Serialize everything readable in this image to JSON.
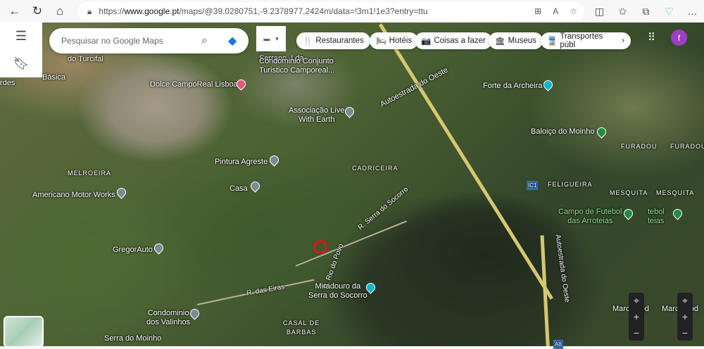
{
  "browser": {
    "url_prefix": "https://",
    "url_domain": "www.google.pt",
    "url_rest": "/maps/@39.0280751,-9.2378977,2424m/data=!3m1!1e3?entry=ttu"
  },
  "search": {
    "placeholder": "Pesquisar no Google Maps"
  },
  "chips": [
    {
      "icon": "🍴",
      "label": "Restaurantes"
    },
    {
      "icon": "🛏",
      "label": "Hotéis"
    },
    {
      "icon": "📷",
      "label": "Coisas a fazer"
    },
    {
      "icon": "🏛",
      "label": "Museus"
    },
    {
      "icon": "🚆",
      "label": "Transportes públ"
    }
  ],
  "avatar": "f",
  "map_labels": {
    "turcifal": "do Turcifal",
    "serrano": "Sar\nSerrano, Lda",
    "condominio": "Condominio Conjunto\nTuristico Camporeal...",
    "dolce": "Dolce CampoReal Lisboa",
    "associacao": "Associação Live\nWith Earth",
    "autoestrada1": "Autoestrada do Oeste",
    "forte": "Forte da Archeira",
    "baloico": "Baloiço do Moinho",
    "furadouro1": "FURADOU",
    "furadouro2": "FURADOURO",
    "melroeira": "MELROEIRA",
    "americano": "Americano Motor Works",
    "pintura": "Pintura Agreste",
    "casa": "Casa",
    "cadriceira": "CADRICEIRA",
    "ic1": "IC1",
    "feligueira": "FELIGUEIRA",
    "mesquita1": "MESQUITA",
    "mesquita2": "MESQUITA",
    "campo": "Campo de Futebol\ndas Arroteias",
    "campo2": "tebol\nteias",
    "serra_socorro": "R. Serra do Socorro",
    "rio_povo": "R. Rio do Povo",
    "gregor": "GregorAuto",
    "autoestrada2": "Autoestrada do Oeste",
    "miradouro": "Miradouro da\nSerra do Socorro",
    "eiras": "R. das Eiras",
    "valinhos": "Condominio\ndos Valinhos",
    "casal": "CASAL DE\nBARBAS",
    "moinho": "Serra do Moinho",
    "marco1": "Marc   eod",
    "marco2": "Marc   eod",
    "rdes": "rdes",
    "basica": "Básica",
    "a8": "A8"
  }
}
